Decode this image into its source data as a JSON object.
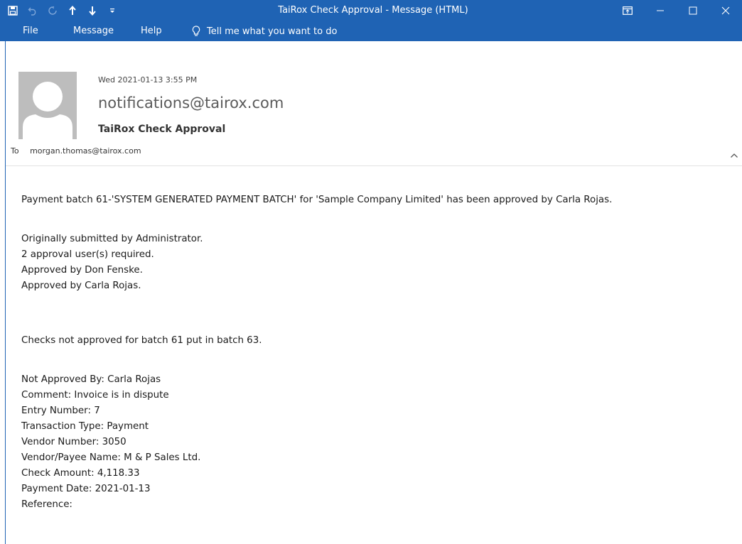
{
  "window": {
    "title": "TaiRox Check Approval  -  Message (HTML)",
    "quick_access": [
      "save-icon",
      "undo-icon",
      "redo-icon",
      "arrow-up-icon",
      "arrow-down-icon",
      "customize-icon"
    ],
    "controls": [
      "ribbon-display-options-icon",
      "minimize-icon",
      "maximize-icon",
      "close-icon"
    ]
  },
  "ribbon": {
    "tabs": [
      "File",
      "Message",
      "Help"
    ],
    "tell_me": "Tell me what you want to do"
  },
  "message": {
    "date": "Wed 2021-01-13 3:55 PM",
    "from": "notifications@tairox.com",
    "subject": "TaiRox Check Approval",
    "to_label": "To",
    "to": "morgan.thomas@tairox.com"
  },
  "body": {
    "lines": [
      "Payment batch 61-'SYSTEM GENERATED PAYMENT BATCH' for 'Sample Company Limited' has been approved by Carla Rojas.",
      "Originally submitted by Administrator.",
      "2 approval user(s) required.",
      "Approved by Don Fenske.",
      "Approved by Carla Rojas.",
      "Checks not approved for batch 61 put in batch 63.",
      "Not Approved By: Carla Rojas",
      "Comment: Invoice is in dispute",
      "Entry Number: 7",
      "Transaction Type: Payment",
      "Vendor Number: 3050",
      "Vendor/Payee Name: M & P Sales Ltd.",
      "Check Amount: 4,118.33",
      "Payment Date: 2021-01-13",
      "Reference:"
    ]
  },
  "colors": {
    "accent": "#1f63b4",
    "avatar_bg": "#bdbdbd",
    "avatar_fg": "#ffffff"
  }
}
